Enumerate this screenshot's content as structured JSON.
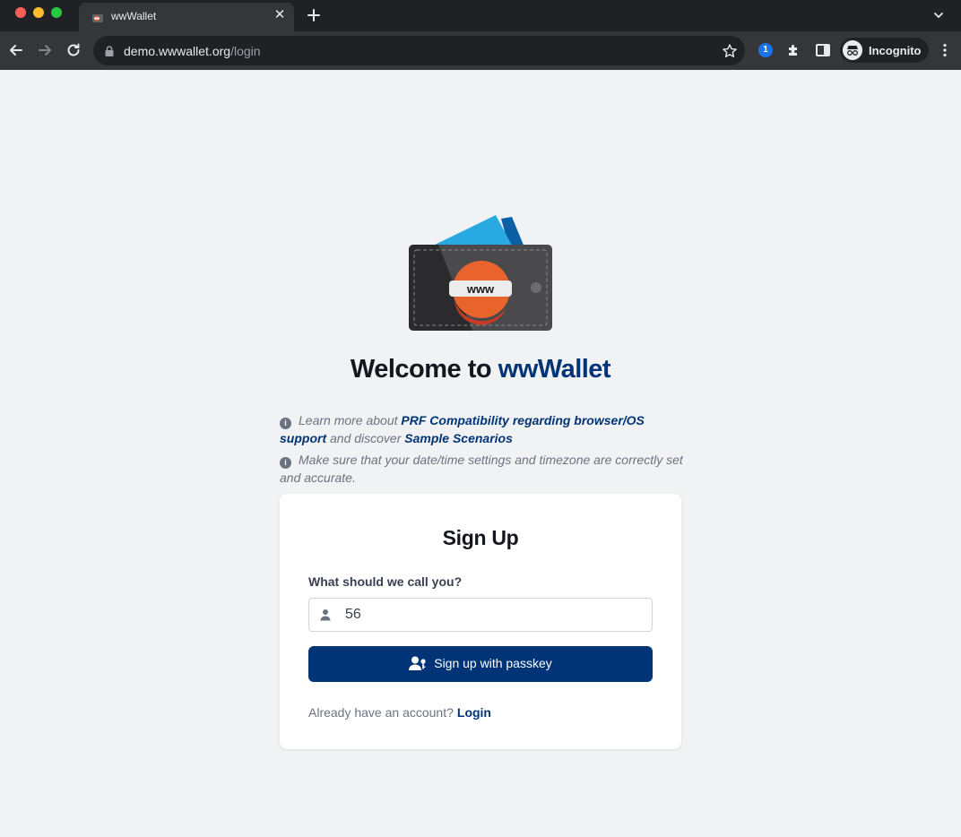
{
  "browser": {
    "tab_title": "wwWallet",
    "url_host": "demo.wwwallet.org",
    "url_path": "/login",
    "profile_label": "Incognito"
  },
  "page": {
    "logo_badge": "www",
    "welcome_prefix": "Welcome to ",
    "welcome_brand": "wwWallet",
    "info1": {
      "text_before": "Learn more about ",
      "link1": "PRF Compatibility regarding browser/OS support",
      "text_mid": " and discover ",
      "link2": "Sample Scenarios"
    },
    "info2": "Make sure that your date/time settings and timezone are correctly set and accurate.",
    "signup": {
      "title": "Sign Up",
      "name_label": "What should we call you?",
      "name_value": "56",
      "submit_label": "Sign up with passkey",
      "footer_text": "Already have an account?",
      "footer_link": "Login"
    }
  },
  "colors": {
    "brand": "#003476",
    "background": "#f1f2f4",
    "chrome_dark": "#202124",
    "chrome_mid": "#35363a"
  }
}
